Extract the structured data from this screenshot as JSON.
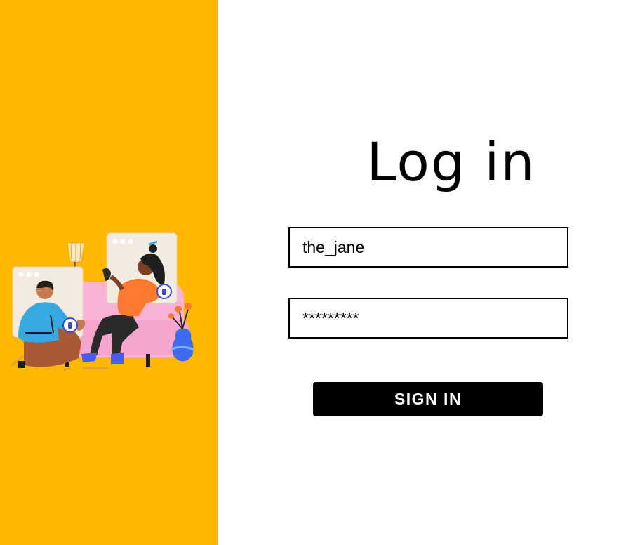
{
  "login": {
    "title": "Log in",
    "username": {
      "value": "the_jane",
      "placeholder": ""
    },
    "password": {
      "value": "*********",
      "placeholder": ""
    },
    "signin_label": "SIGN IN"
  },
  "colors": {
    "left_panel_bg": "#FFB800",
    "button_bg": "#000000",
    "button_text": "#FFFFFF",
    "field_border": "#000000"
  },
  "illustration": {
    "icon": "video-call-illustration"
  }
}
